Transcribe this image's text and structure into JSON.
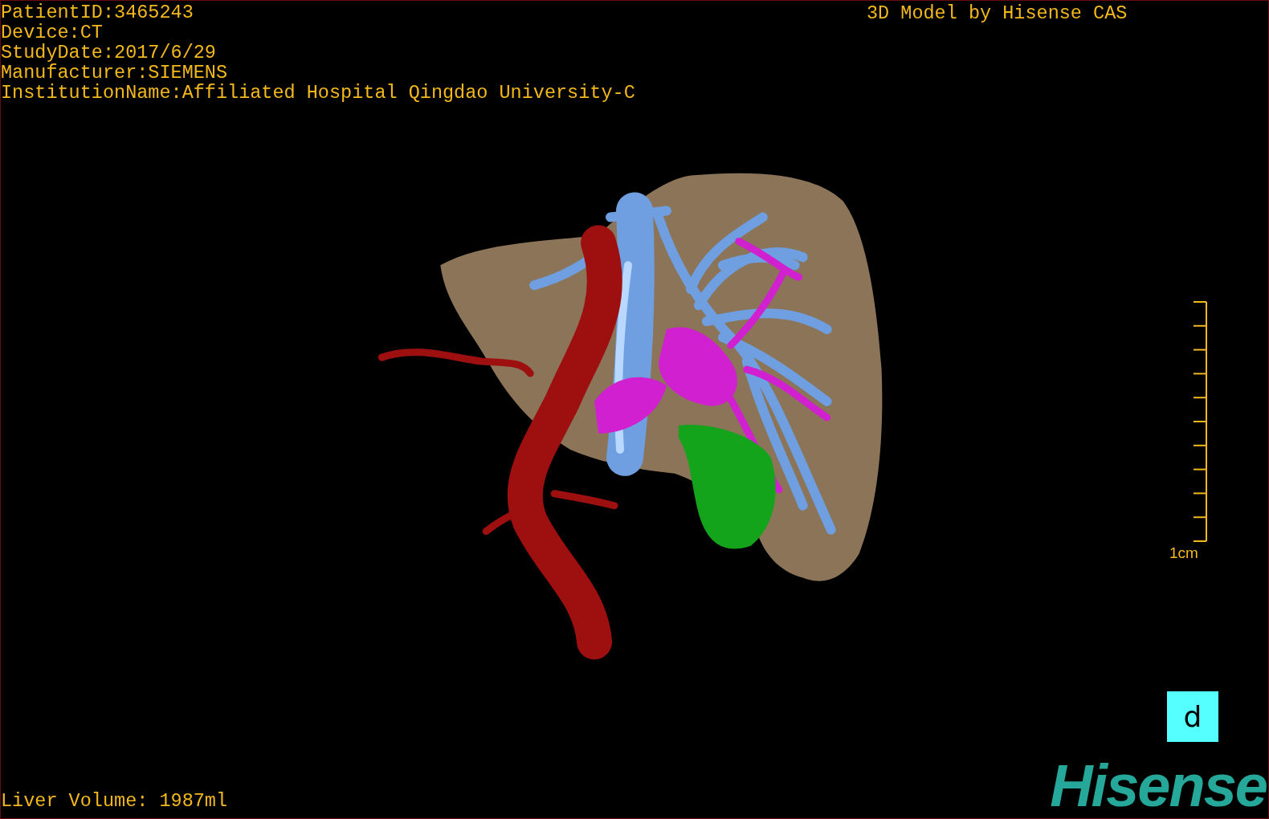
{
  "info_lines": [
    "PatientID:3465243",
    "Device:CT",
    "StudyDate:2017/6/29",
    "Manufacturer:SIEMENS",
    "InstitutionName:Affiliated Hospital Qingdao University-C"
  ],
  "model_credit": "3D Model by Hisense CAS",
  "scale_bar": {
    "label": "1cm"
  },
  "panel_label": "d",
  "liver_volume": "Liver Volume: 1987ml",
  "logo": "Hisense"
}
